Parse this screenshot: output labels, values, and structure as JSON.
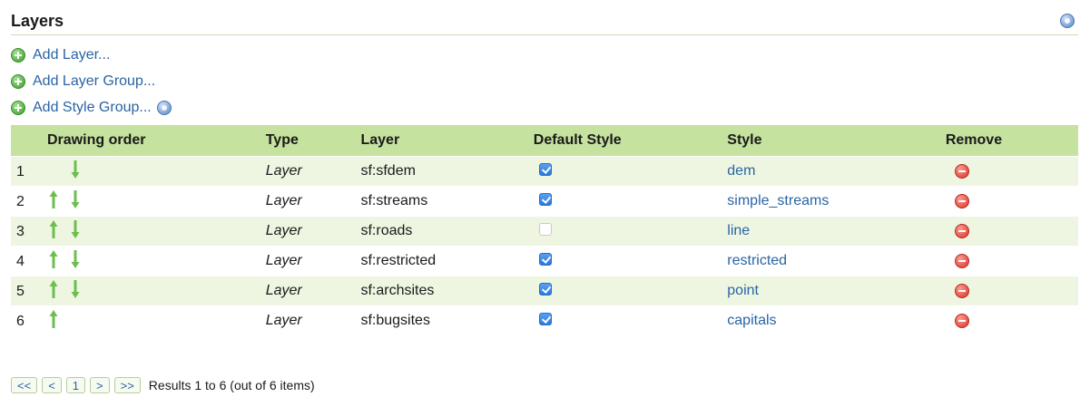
{
  "header": {
    "title": "Layers",
    "help_icon": "help-icon"
  },
  "actions": [
    {
      "label": "Add Layer...",
      "icon": "add-icon"
    },
    {
      "label": "Add Layer Group...",
      "icon": "add-icon"
    },
    {
      "label": "Add Style Group...",
      "icon": "add-icon",
      "help": true
    }
  ],
  "table": {
    "columns": [
      "Drawing order",
      "Type",
      "Layer",
      "Default Style",
      "Style",
      "Remove"
    ],
    "rows": [
      {
        "order": "1",
        "up": false,
        "down": true,
        "type": "Layer",
        "layer": "sf:sfdem",
        "default_style": true,
        "style": "dem"
      },
      {
        "order": "2",
        "up": true,
        "down": true,
        "type": "Layer",
        "layer": "sf:streams",
        "default_style": true,
        "style": "simple_streams"
      },
      {
        "order": "3",
        "up": true,
        "down": true,
        "type": "Layer",
        "layer": "sf:roads",
        "default_style": false,
        "style": "line"
      },
      {
        "order": "4",
        "up": true,
        "down": true,
        "type": "Layer",
        "layer": "sf:restricted",
        "default_style": true,
        "style": "restricted"
      },
      {
        "order": "5",
        "up": true,
        "down": true,
        "type": "Layer",
        "layer": "sf:archsites",
        "default_style": true,
        "style": "point"
      },
      {
        "order": "6",
        "up": true,
        "down": false,
        "type": "Layer",
        "layer": "sf:bugsites",
        "default_style": true,
        "style": "capitals"
      }
    ]
  },
  "pager": {
    "buttons": [
      "<<",
      "<",
      "1",
      ">",
      ">>"
    ],
    "status": "Results 1 to 6 (out of 6 items)"
  },
  "colors": {
    "accent_green": "#c5e29e",
    "row_stripe": "#eef6e2",
    "link_blue": "#2a64a4",
    "arrow_green": "#6cbf4f"
  }
}
